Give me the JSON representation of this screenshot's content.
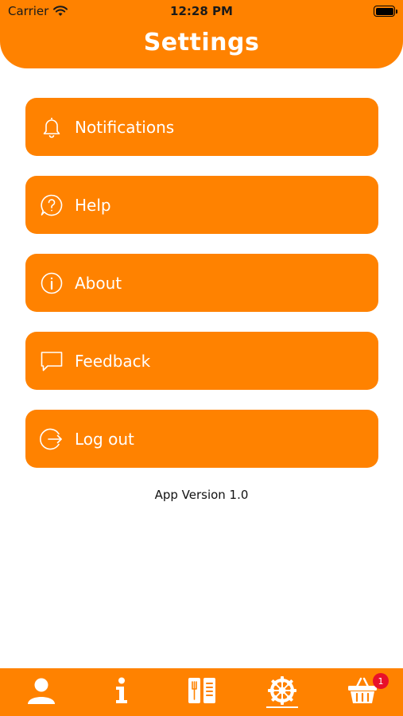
{
  "status_bar": {
    "carrier": "Carrier",
    "time": "12:28 PM"
  },
  "header": {
    "title": "Settings"
  },
  "menu": [
    {
      "label": "Notifications",
      "icon": "bell-icon"
    },
    {
      "label": "Help",
      "icon": "question-bubble-icon"
    },
    {
      "label": "About",
      "icon": "info-circle-icon"
    },
    {
      "label": "Feedback",
      "icon": "chat-bubble-icon"
    },
    {
      "label": "Log out",
      "icon": "logout-icon"
    }
  ],
  "footer": {
    "version": "App Version 1.0"
  },
  "tabbar": {
    "tabs": [
      {
        "icon": "user-icon"
      },
      {
        "icon": "info-icon"
      },
      {
        "icon": "menu-book-icon"
      },
      {
        "icon": "settings-wheel-icon",
        "selected": true
      },
      {
        "icon": "basket-icon",
        "badge": "1"
      }
    ]
  },
  "colors": {
    "accent": "#FF8200",
    "badge": "#E8102A",
    "text_on_accent": "#FFFFFF"
  }
}
